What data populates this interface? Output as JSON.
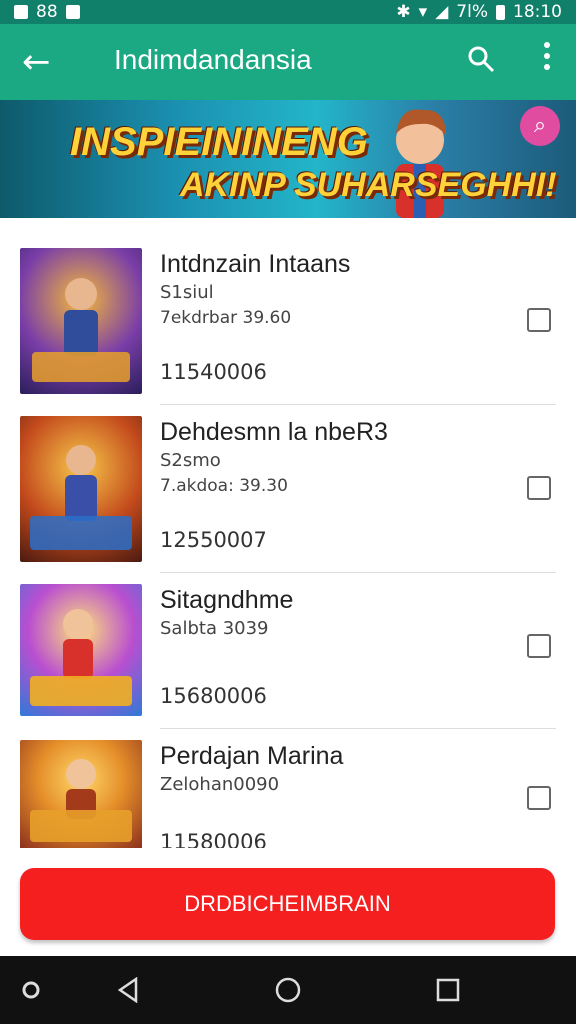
{
  "status_bar": {
    "left_text": "88",
    "battery": "7l%",
    "time": "18:10"
  },
  "app_bar": {
    "title": "Indimdandansia"
  },
  "banner": {
    "line1": "INSPIEININENG",
    "line2": "AKINP SUHARSEGHHI!"
  },
  "items": [
    {
      "name": "Intdnzain Intaans",
      "sub1": "S1siul",
      "sub2": "7ekdrbar 39.60",
      "price": "11540006",
      "checked": false,
      "colors": [
        "#3b2a8a",
        "#e3a12a"
      ]
    },
    {
      "name": "Dehdesmn la nbeR3",
      "sub1": "S2smo",
      "sub2": "7.akdoa: 39.30",
      "price": "12550007",
      "checked": false,
      "colors": [
        "#c34a1c",
        "#f0b33a"
      ]
    },
    {
      "name": "Sitagndhme",
      "sub1": "Salbta 3039",
      "sub2": "",
      "price": "15680006",
      "checked": false,
      "colors": [
        "#2f79d8",
        "#b94fd0"
      ]
    },
    {
      "name": "Perdajan Marina",
      "sub1": "Zelohan0090",
      "sub2": "",
      "price": "11580006",
      "checked": false,
      "colors": [
        "#8a2d1c",
        "#e58f2a"
      ]
    }
  ],
  "cta": {
    "label": "DRDBICHEIMBRAIN"
  },
  "colors": {
    "appbar": "#1aa982",
    "status": "#11806a",
    "cta": "#f51f1f"
  }
}
